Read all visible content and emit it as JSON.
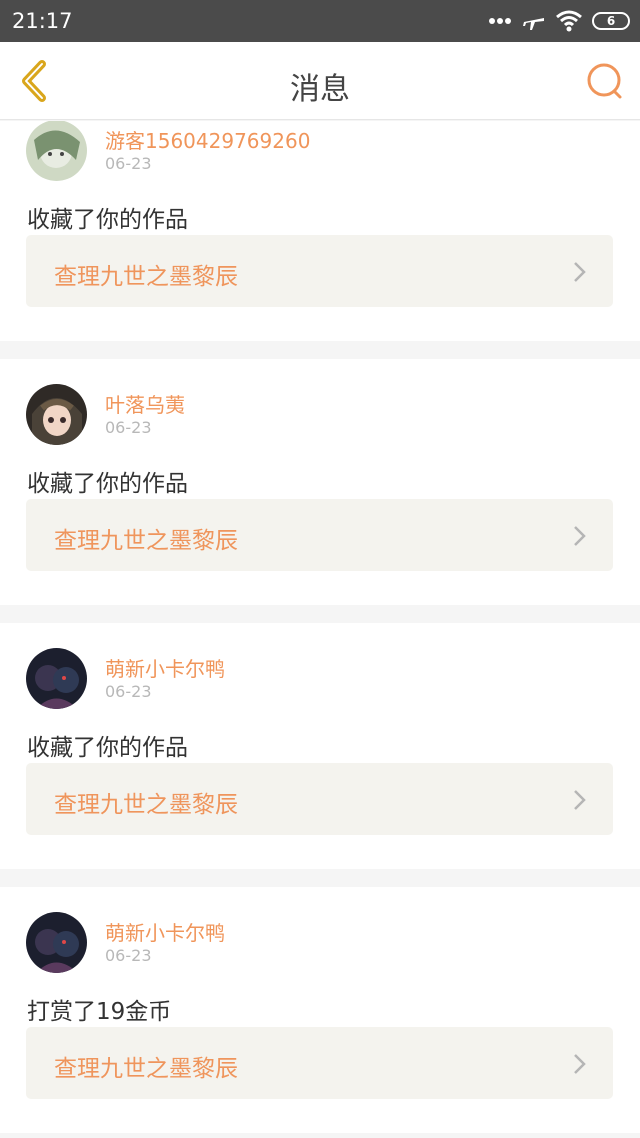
{
  "status_bar": {
    "time": "21:17",
    "battery": "6"
  },
  "header": {
    "title": "消息"
  },
  "colors": {
    "accent": "#f0955a",
    "back": "#d9a61c"
  },
  "messages": [
    {
      "user": "游客1560429769260",
      "date": "06-23",
      "action": "收藏了你的作品",
      "work": "查理九世之墨黎辰"
    },
    {
      "user": "叶落乌荑",
      "date": "06-23",
      "action": "收藏了你的作品",
      "work": "查理九世之墨黎辰"
    },
    {
      "user": "萌新小卡尔鸭",
      "date": "06-23",
      "action": "收藏了你的作品",
      "work": "查理九世之墨黎辰"
    },
    {
      "user": "萌新小卡尔鸭",
      "date": "06-23",
      "action": "打赏了19金币",
      "work": "查理九世之墨黎辰"
    }
  ]
}
